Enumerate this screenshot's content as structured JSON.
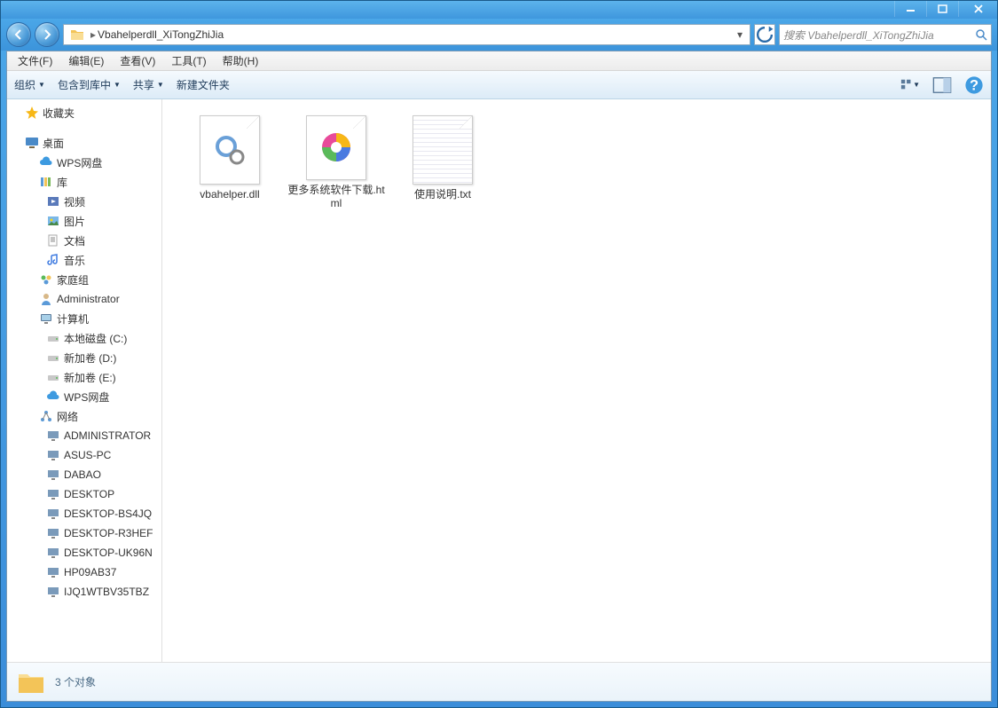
{
  "titlebar": {},
  "nav": {
    "path": "Vbahelperdll_XiTongZhiJia",
    "search_placeholder": "搜索 Vbahelperdll_XiTongZhiJia"
  },
  "menu": {
    "file": "文件(F)",
    "edit": "编辑(E)",
    "view": "查看(V)",
    "tools": "工具(T)",
    "help": "帮助(H)"
  },
  "toolbar": {
    "organize": "组织",
    "include": "包含到库中",
    "share": "共享",
    "newfolder": "新建文件夹"
  },
  "sidebar": {
    "favorites": "收藏夹",
    "desktop": "桌面",
    "wps": "WPS网盘",
    "library": "库",
    "videos": "视频",
    "pictures": "图片",
    "documents": "文档",
    "music": "音乐",
    "homegroup": "家庭组",
    "admin": "Administrator",
    "computer": "计算机",
    "drive_c": "本地磁盘 (C:)",
    "drive_d": "新加卷 (D:)",
    "drive_e": "新加卷 (E:)",
    "wps2": "WPS网盘",
    "network": "网络",
    "n1": "ADMINISTRATOR",
    "n2": "ASUS-PC",
    "n3": "DABAO",
    "n4": "DESKTOP",
    "n5": "DESKTOP-BS4JQ",
    "n6": "DESKTOP-R3HEF",
    "n7": "DESKTOP-UK96N",
    "n8": "HP09AB37",
    "n9": "IJQ1WTBV35TBZ"
  },
  "files": [
    {
      "name": "vbahelper.dll",
      "type": "dll"
    },
    {
      "name": "更多系统软件下载.html",
      "type": "html"
    },
    {
      "name": "使用说明.txt",
      "type": "txt"
    }
  ],
  "status": {
    "text": "3 个对象"
  }
}
